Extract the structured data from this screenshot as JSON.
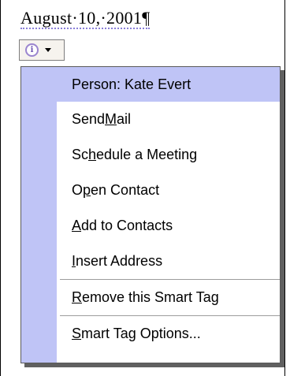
{
  "document": {
    "text": "August·10,·2001¶"
  },
  "smart_tag": {
    "icon": "info-icon",
    "arrow": "chevron-down-icon"
  },
  "menu": {
    "header": "Person: Kate Evert",
    "items": [
      {
        "pre": "Send ",
        "key": "M",
        "post": "ail"
      },
      {
        "pre": "Sc",
        "key": "h",
        "post": "edule a Meeting"
      },
      {
        "pre": "O",
        "key": "p",
        "post": "en Contact"
      },
      {
        "pre": "",
        "key": "A",
        "post": "dd to Contacts"
      },
      {
        "pre": "",
        "key": "I",
        "post": "nsert Address"
      }
    ],
    "remove": {
      "pre": "",
      "key": "R",
      "post": "emove this Smart Tag"
    },
    "options": {
      "pre": "",
      "key": "S",
      "post": "mart Tag Options..."
    }
  },
  "colors": {
    "menu_gutter": "#bfc4f6",
    "highlight": "#bfc4f6",
    "smart_tag_underline": "#8a7fd8"
  }
}
